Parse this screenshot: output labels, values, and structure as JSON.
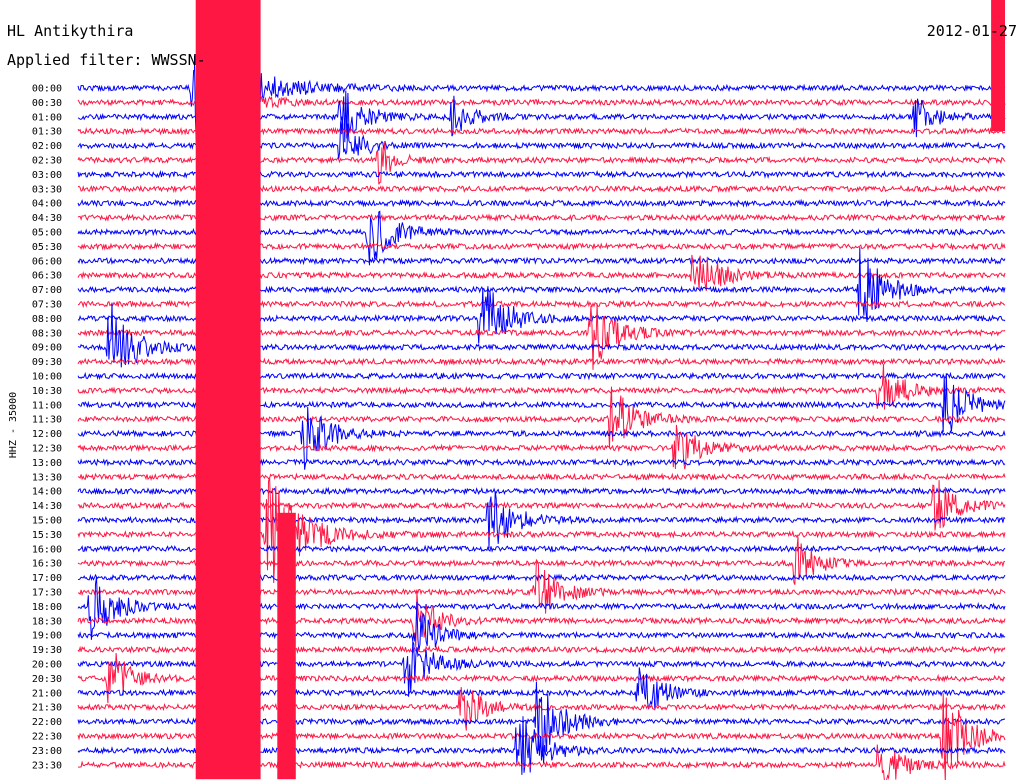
{
  "chart_data": {
    "type": "line",
    "title": "HL Antikythira",
    "date": "2012-01-27",
    "filter_label": "Applied filter: WWSSN-",
    "ylabel": "HHZ - 35000",
    "row_labels": [
      "00:00",
      "00:30",
      "01:00",
      "01:30",
      "02:00",
      "02:30",
      "03:00",
      "03:30",
      "04:00",
      "04:30",
      "05:00",
      "05:30",
      "06:00",
      "06:30",
      "07:00",
      "07:30",
      "08:00",
      "08:30",
      "09:00",
      "09:30",
      "10:00",
      "10:30",
      "11:00",
      "11:30",
      "12:00",
      "12:30",
      "13:00",
      "13:30",
      "14:00",
      "14:30",
      "15:00",
      "15:30",
      "16:00",
      "16:30",
      "17:00",
      "17:30",
      "18:00",
      "18:30",
      "19:00",
      "19:30",
      "20:00",
      "20:30",
      "21:00",
      "21:30",
      "22:00",
      "22:30",
      "23:00",
      "23:30"
    ],
    "series_colors": [
      "#0000ff",
      "#ff1744"
    ],
    "background": "#ffffff",
    "events": [
      {
        "row": 0,
        "t": 0.12,
        "amp": 5,
        "len": 0.1
      },
      {
        "row": 1,
        "t": 0.13,
        "amp": 4,
        "len": 0.06
      },
      {
        "row": 2,
        "t": 0.28,
        "amp": 2.5,
        "len": 0.05
      },
      {
        "row": 2,
        "t": 0.4,
        "amp": 2,
        "len": 0.04
      },
      {
        "row": 2,
        "t": 0.9,
        "amp": 2,
        "len": 0.04
      },
      {
        "row": 4,
        "t": 0.28,
        "amp": 2.5,
        "len": 0.04
      },
      {
        "row": 5,
        "t": 0.32,
        "amp": 2.5,
        "len": 0.03
      },
      {
        "row": 10,
        "t": 0.31,
        "amp": 3,
        "len": 0.05
      },
      {
        "row": 13,
        "t": 0.66,
        "amp": 3,
        "len": 0.05
      },
      {
        "row": 14,
        "t": 0.84,
        "amp": 4,
        "len": 0.05
      },
      {
        "row": 16,
        "t": 0.43,
        "amp": 4,
        "len": 0.05
      },
      {
        "row": 17,
        "t": 0.55,
        "amp": 3.5,
        "len": 0.05
      },
      {
        "row": 18,
        "t": 0.03,
        "amp": 4,
        "len": 0.05
      },
      {
        "row": 21,
        "t": 0.86,
        "amp": 2.5,
        "len": 0.05
      },
      {
        "row": 22,
        "t": 0.93,
        "amp": 3,
        "len": 0.05
      },
      {
        "row": 23,
        "t": 0.57,
        "amp": 3,
        "len": 0.05
      },
      {
        "row": 24,
        "t": 0.24,
        "amp": 3,
        "len": 0.05
      },
      {
        "row": 25,
        "t": 0.64,
        "amp": 2.5,
        "len": 0.05
      },
      {
        "row": 29,
        "t": 0.92,
        "amp": 2.5,
        "len": 0.05
      },
      {
        "row": 30,
        "t": 0.44,
        "amp": 3,
        "len": 0.05
      },
      {
        "row": 31,
        "t": 0.2,
        "amp": 5,
        "len": 0.07
      },
      {
        "row": 33,
        "t": 0.77,
        "amp": 2.5,
        "len": 0.04
      },
      {
        "row": 35,
        "t": 0.49,
        "amp": 2.5,
        "len": 0.05
      },
      {
        "row": 36,
        "t": 0.01,
        "amp": 3,
        "len": 0.05
      },
      {
        "row": 37,
        "t": 0.36,
        "amp": 3,
        "len": 0.04
      },
      {
        "row": 38,
        "t": 0.36,
        "amp": 3,
        "len": 0.04
      },
      {
        "row": 40,
        "t": 0.35,
        "amp": 3,
        "len": 0.05
      },
      {
        "row": 41,
        "t": 0.03,
        "amp": 3,
        "len": 0.04
      },
      {
        "row": 42,
        "t": 0.6,
        "amp": 2.5,
        "len": 0.05
      },
      {
        "row": 43,
        "t": 0.41,
        "amp": 2.5,
        "len": 0.04
      },
      {
        "row": 44,
        "t": 0.49,
        "amp": 4,
        "len": 0.05
      },
      {
        "row": 45,
        "t": 0.93,
        "amp": 4,
        "len": 0.05
      },
      {
        "row": 46,
        "t": 0.47,
        "amp": 3.5,
        "len": 0.05
      },
      {
        "row": 47,
        "t": 0.86,
        "amp": 2.5,
        "len": 0.05
      }
    ],
    "saturated_bands": [
      {
        "t0": 0.127,
        "t1": 0.197,
        "row0": 0,
        "row1": 47
      },
      {
        "t0": 0.215,
        "t1": 0.235,
        "row0": 30,
        "row1": 47
      },
      {
        "t0": 0.985,
        "t1": 1.0,
        "row0": 0,
        "row1": 2
      }
    ],
    "grid": false,
    "legend": "none"
  }
}
